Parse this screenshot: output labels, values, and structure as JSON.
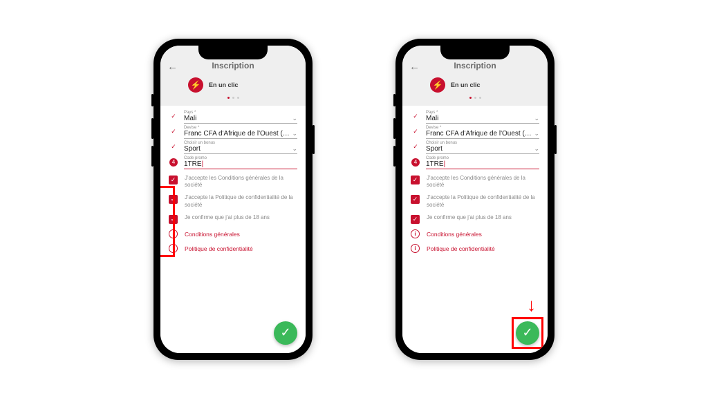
{
  "title": "Inscription",
  "subtitle": "En un clic",
  "fields": {
    "country": {
      "label": "Pays *",
      "value": "Mali"
    },
    "currency": {
      "label": "Devise *",
      "value": "Franc CFA d'Afrique de l'Ouest (…"
    },
    "bonus": {
      "label": "Choisir un bonus",
      "value": "Sport"
    },
    "promo": {
      "label": "Code promo",
      "value": "1TRE",
      "badge": "4"
    }
  },
  "checks": {
    "terms": "J'accepte les Conditions générales de la société",
    "privacy": "J'accepte la Politique de confidentialité de la société",
    "age": "Je confirme que j'ai plus de 18 ans"
  },
  "links": {
    "terms": "Conditions générales",
    "privacy": "Politique de confidentialité"
  }
}
